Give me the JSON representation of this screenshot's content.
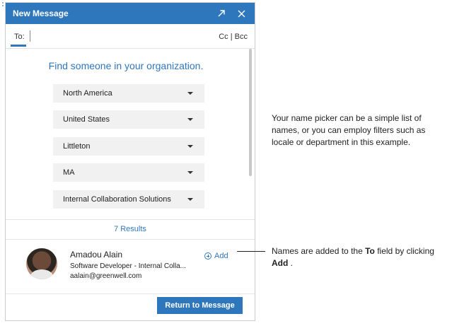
{
  "dialog": {
    "title": "New Message",
    "to_label": "To:",
    "cc_bcc": "Cc | Bcc",
    "heading": "Find someone in your organization.",
    "filters": [
      "North America",
      "United States",
      "Littleton",
      "MA",
      "Internal Collaboration Solutions"
    ],
    "results": "7 Results",
    "person": {
      "name": "Amadou Alain",
      "title": "Software Developer - Internal Colla...",
      "email": "aalain@greenwell.com",
      "add_label": "Add"
    },
    "return_label": "Return to Message",
    "icons": {
      "expand": "expand-icon",
      "close": "close-icon",
      "add": "add-circle-icon",
      "caret": "caret-down-icon"
    },
    "accent_color": "#2f77bd"
  },
  "annotations": {
    "note1": "Your name picker can be a simple list of names, or you can employ filters such as locale or department in this example.",
    "note2": {
      "prefix": "Names are added to the",
      "field": "To",
      "middle": "field by clicking",
      "action": "Add",
      "suffix": "."
    }
  }
}
